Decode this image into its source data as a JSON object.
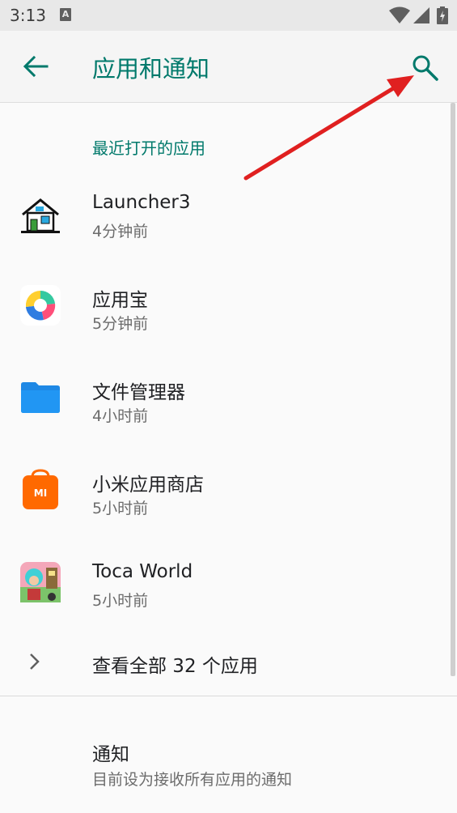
{
  "status_bar": {
    "time": "3:13",
    "notif_letter": "A"
  },
  "header": {
    "title": "应用和通知"
  },
  "recent": {
    "section_title": "最近打开的应用",
    "apps": [
      {
        "name": "Launcher3",
        "time": "4分钟前",
        "icon": "launcher-house-icon"
      },
      {
        "name": "应用宝",
        "time": "5分钟前",
        "icon": "yingyongbao-icon"
      },
      {
        "name": "文件管理器",
        "time": "4小时前",
        "icon": "folder-icon"
      },
      {
        "name": "小米应用商店",
        "time": "5小时前",
        "icon": "mi-store-icon"
      },
      {
        "name": "Toca World",
        "time": "5小时前",
        "icon": "toca-world-icon"
      }
    ]
  },
  "see_all": {
    "label": "查看全部 32 个应用"
  },
  "notifications": {
    "label": "通知",
    "sub": "目前设为接收所有应用的通知"
  },
  "colors": {
    "accent": "#00796b",
    "annotation": "#e02020"
  },
  "mi_logo_text": "MI"
}
